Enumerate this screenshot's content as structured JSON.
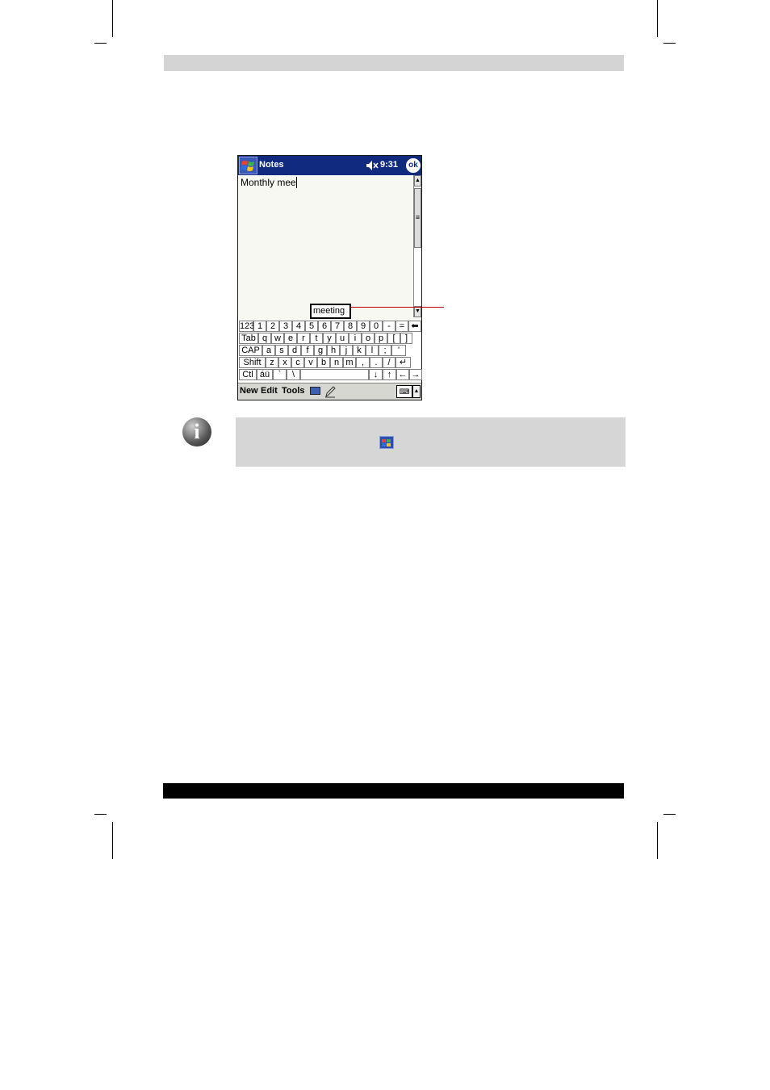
{
  "device": {
    "app_title": "Notes",
    "time": "9:31",
    "ok_label": "ok",
    "note_text": "Monthly mee",
    "suggestion": "meeting"
  },
  "keyboard": {
    "rows": [
      [
        {
          "label": "123",
          "w": 18
        },
        {
          "label": "1",
          "w": 16
        },
        {
          "label": "2",
          "w": 16
        },
        {
          "label": "3",
          "w": 16
        },
        {
          "label": "4",
          "w": 16
        },
        {
          "label": "5",
          "w": 16
        },
        {
          "label": "6",
          "w": 16
        },
        {
          "label": "7",
          "w": 16
        },
        {
          "label": "8",
          "w": 16
        },
        {
          "label": "9",
          "w": 16
        },
        {
          "label": "0",
          "w": 16
        },
        {
          "label": "-",
          "w": 16
        },
        {
          "label": "=",
          "w": 16
        },
        {
          "label": "⬅",
          "w": 16
        }
      ],
      [
        {
          "label": "Tab",
          "w": 24
        },
        {
          "label": "q",
          "w": 16
        },
        {
          "label": "w",
          "w": 16
        },
        {
          "label": "e",
          "w": 16
        },
        {
          "label": "r",
          "w": 16
        },
        {
          "label": "t",
          "w": 16
        },
        {
          "label": "y",
          "w": 16
        },
        {
          "label": "u",
          "w": 16
        },
        {
          "label": "i",
          "w": 16
        },
        {
          "label": "o",
          "w": 16
        },
        {
          "label": "p",
          "w": 16
        },
        {
          "label": "[",
          "w": 16
        },
        {
          "label": "]",
          "w": 15
        }
      ],
      [
        {
          "label": "CAP",
          "w": 29
        },
        {
          "label": "a",
          "w": 16
        },
        {
          "label": "s",
          "w": 16
        },
        {
          "label": "d",
          "w": 16
        },
        {
          "label": "f",
          "w": 16
        },
        {
          "label": "g",
          "w": 16
        },
        {
          "label": "h",
          "w": 16
        },
        {
          "label": "j",
          "w": 16
        },
        {
          "label": "k",
          "w": 16
        },
        {
          "label": "l",
          "w": 16
        },
        {
          "label": ";",
          "w": 16
        },
        {
          "label": "'",
          "w": 18
        }
      ],
      [
        {
          "label": "Shift",
          "w": 33
        },
        {
          "label": "z",
          "w": 16
        },
        {
          "label": "x",
          "w": 16
        },
        {
          "label": "c",
          "w": 16
        },
        {
          "label": "v",
          "w": 16
        },
        {
          "label": "b",
          "w": 16
        },
        {
          "label": "n",
          "w": 16
        },
        {
          "label": "m",
          "w": 16
        },
        {
          "label": ",",
          "w": 17
        },
        {
          "label": ".",
          "w": 16
        },
        {
          "label": "/",
          "w": 16
        },
        {
          "label": "↵",
          "w": 19
        }
      ],
      [
        {
          "label": "Ctl",
          "w": 22
        },
        {
          "label": "áü",
          "w": 20
        },
        {
          "label": "`",
          "w": 17
        },
        {
          "label": "\\",
          "w": 17
        },
        {
          "label": "",
          "w": 85
        },
        {
          "label": "↓",
          "w": 17
        },
        {
          "label": "↑",
          "w": 17
        },
        {
          "label": "←",
          "w": 16
        },
        {
          "label": "→",
          "w": 16
        }
      ]
    ]
  },
  "menubar": {
    "items": [
      "New",
      "Edit",
      "Tools"
    ]
  }
}
